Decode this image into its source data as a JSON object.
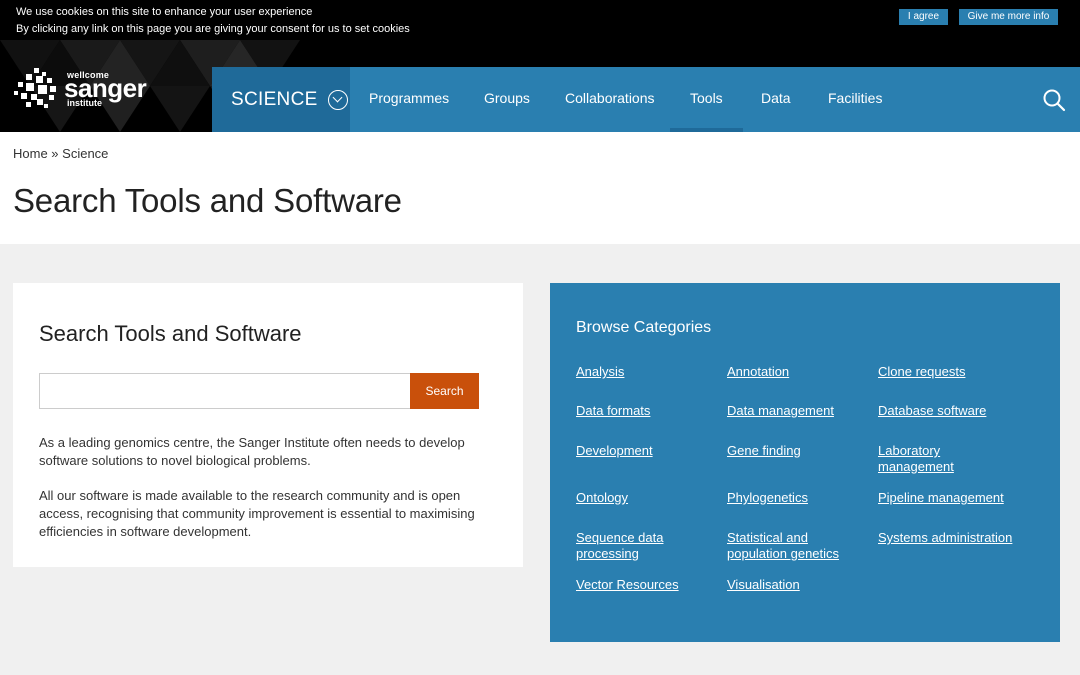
{
  "cookie": {
    "line1": "We use cookies on this site to enhance your user experience",
    "line2": "By clicking any link on this page you are giving your consent for us to set cookies",
    "agree_label": "I agree",
    "more_label": "Give me more info"
  },
  "logo": {
    "wellcome": "wellcome",
    "sanger": "sanger",
    "institute": "institute"
  },
  "nav": {
    "science_label": "SCIENCE",
    "items": [
      "Programmes",
      "Groups",
      "Collaborations",
      "Tools",
      "Data",
      "Facilities"
    ],
    "active": "Tools",
    "search_icon": "search-icon"
  },
  "breadcrumb": {
    "home": "Home",
    "separator": " » ",
    "current": "Science"
  },
  "page_title": "Search Tools and Software",
  "search_card": {
    "title": "Search Tools and Software",
    "input_value": "",
    "button_label": "Search",
    "para1": "As a leading genomics centre, the Sanger Institute often needs to develop software solutions to novel biological problems.",
    "para2": "All our software is made available to the research community and is open access, recognising that community improvement is essential to maximising efficiencies in software development."
  },
  "browse": {
    "title": "Browse Categories",
    "categories": [
      "Analysis",
      "Annotation",
      "Clone requests",
      "Data formats",
      "Data management",
      "Database software",
      "Development",
      "Gene finding",
      "Laboratory management",
      "Ontology",
      "Phylogenetics",
      "Pipeline management",
      "Sequence data processing",
      "Statistical and population genetics",
      "Systems administration",
      "Vector Resources",
      "Visualisation"
    ]
  },
  "colors": {
    "nav_blue": "#2a7fb0",
    "nav_dark": "#1f6a99",
    "search_orange": "#c9500b"
  }
}
